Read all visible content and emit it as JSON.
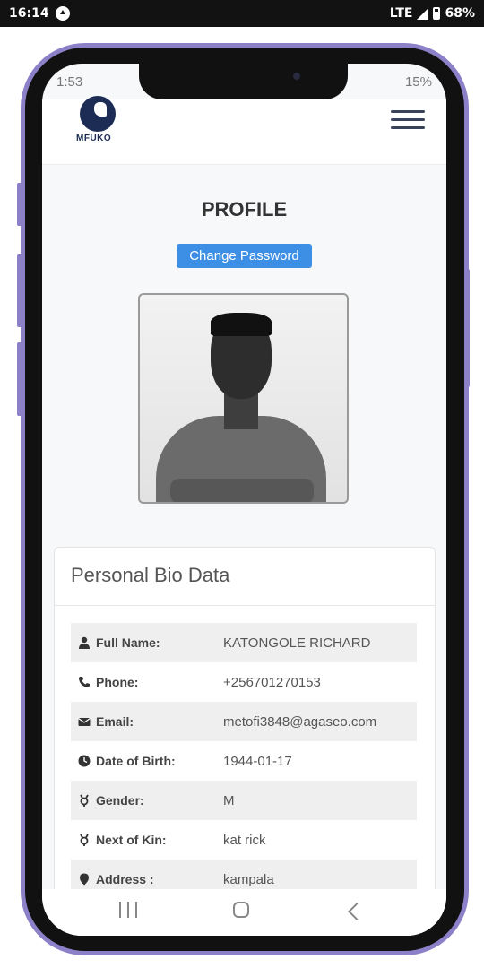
{
  "system_status": {
    "time": "16:14",
    "network": "LTE",
    "battery": "68%"
  },
  "inner_status": {
    "time": "1:53",
    "battery": "15%"
  },
  "header": {
    "logo_text": "MFUKO"
  },
  "page": {
    "title": "PROFILE",
    "change_password_label": "Change Password"
  },
  "bio_card": {
    "title": "Personal Bio Data",
    "rows": [
      {
        "label": "Full Name:",
        "value": "KATONGOLE RICHARD",
        "icon": "user-icon"
      },
      {
        "label": "Phone:",
        "value": "+256701270153",
        "icon": "phone-icon"
      },
      {
        "label": "Email:",
        "value": "metofi3848@agaseo.com",
        "icon": "envelope-icon"
      },
      {
        "label": "Date of Birth:",
        "value": "1944-01-17",
        "icon": "clock-icon"
      },
      {
        "label": "Gender:",
        "value": "M",
        "icon": "gender-icon"
      },
      {
        "label": "Next of Kin:",
        "value": "kat rick",
        "icon": "gender-icon"
      },
      {
        "label": "Address :",
        "value": "kampala",
        "icon": "map-marker-icon"
      }
    ]
  },
  "colors": {
    "frame": "#8c80c8",
    "accent": "#3d8fe6",
    "logo": "#1c2c55"
  }
}
